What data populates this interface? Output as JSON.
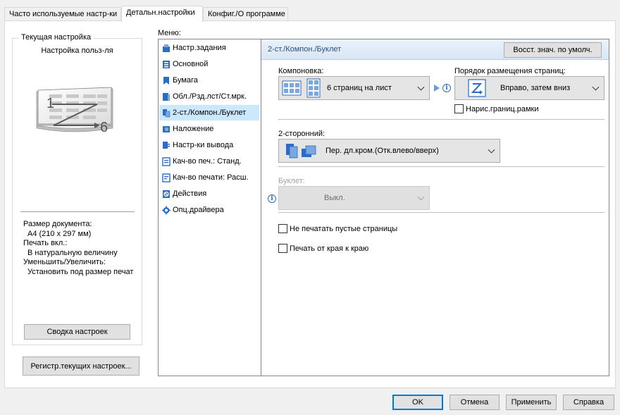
{
  "tabs": [
    {
      "label": "Часто используемые настр-ки"
    },
    {
      "label": "Детальн.настройки"
    },
    {
      "label": "Конфиг./О программе"
    }
  ],
  "left": {
    "group_title": "Текущая настройка",
    "preset_name": "Настройка польз-ля",
    "preview_first": "1",
    "preview_last": "6",
    "doc_size_label": "Размер документа:",
    "doc_size_value": "A4 (210 x 297 мм)",
    "print_on_label": "Печать вкл.:",
    "print_on_value": "В натуральную величину",
    "scale_label": "Уменьшить/Увеличить:",
    "scale_value": "Установить под размер печат",
    "summary_button": "Сводка настроек",
    "register_button": "Регистр.текущих настроек..."
  },
  "menu": {
    "title": "Меню:",
    "items": [
      {
        "label": "Настр.задания",
        "icon": "job-settings-icon"
      },
      {
        "label": "Основной",
        "icon": "basic-icon"
      },
      {
        "label": "Бумага",
        "icon": "paper-icon"
      },
      {
        "label": "Обл./Рзд.лст/Ст.мрк.",
        "icon": "cover-icon"
      },
      {
        "label": "2-ст./Компон./Буклет",
        "icon": "duplex-layout-icon"
      },
      {
        "label": "Наложение",
        "icon": "overlay-icon"
      },
      {
        "label": "Настр-ки вывода",
        "icon": "output-icon"
      },
      {
        "label": "Кач-во печ.: Станд.",
        "icon": "quality-standard-icon"
      },
      {
        "label": "Кач-во печати: Расш.",
        "icon": "quality-advanced-icon"
      },
      {
        "label": "Действия",
        "icon": "actions-icon"
      },
      {
        "label": "Опц.драйвера",
        "icon": "driver-options-icon"
      }
    ],
    "selected_index": 4
  },
  "panel": {
    "title": "2-ст./Компон./Буклет",
    "restore_button": "Восст. знач. по умолч.",
    "layout_label": "Компоновка:",
    "layout_value": "6 страниц на лист",
    "order_label": "Порядок размещения страниц:",
    "order_value": "Вправо, затем вниз",
    "draw_frames_label": "Нарис.границ.рамки",
    "draw_frames_checked": false,
    "duplex_label": "2-сторонний:",
    "duplex_value": "Пер. дл.кром.(Отк.влево/вверх)",
    "booklet_label": "Буклет:",
    "booklet_value": "Выкл.",
    "skip_blank_label": "Не печатать пустые страницы",
    "skip_blank_checked": false,
    "edge_to_edge_label": "Печать от края к краю",
    "edge_to_edge_checked": false
  },
  "footer": {
    "ok": "OK",
    "cancel": "Отмена",
    "apply": "Применить",
    "help": "Справка"
  },
  "colors": {
    "accent": "#0078d7",
    "selection": "#cce8ff",
    "header": "#dde8f5",
    "icon_blue": "#2b6cc4"
  }
}
